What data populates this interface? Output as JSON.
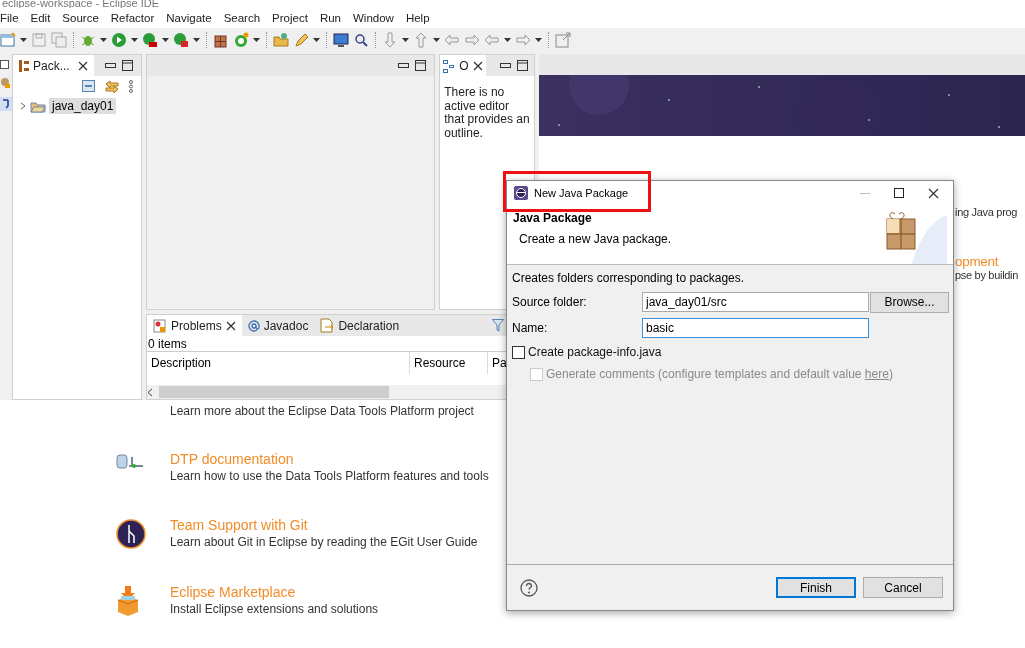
{
  "window": {
    "title": "eclipse-workspace - Eclipse IDE"
  },
  "menu": [
    "File",
    "Edit",
    "Source",
    "Refactor",
    "Navigate",
    "Search",
    "Project",
    "Run",
    "Window",
    "Help"
  ],
  "package_explorer": {
    "tab": {
      "label": "Pack...",
      "selected": true
    },
    "tree": [
      {
        "label": "java_day01",
        "expanded": false,
        "selected": true
      }
    ]
  },
  "outline": {
    "tab": {
      "label": "O",
      "selected": true
    },
    "message": "There is no active editor that provides an outline."
  },
  "problems": {
    "tabs": [
      {
        "label": "Problems",
        "selected": true,
        "kind": "problems"
      },
      {
        "label": "Javadoc",
        "selected": false,
        "kind": "javadoc"
      },
      {
        "label": "Declaration",
        "selected": false,
        "kind": "declaration"
      }
    ],
    "summary": "0 items",
    "columns": [
      "Description",
      "Resource",
      "Pa"
    ]
  },
  "welcome": {
    "partial_lines": [
      {
        "text": "ing Java prog",
        "kind": "desc"
      },
      {
        "text": "opment",
        "kind": "link"
      },
      {
        "text": "pse by buildin",
        "kind": "desc"
      }
    ],
    "items": [
      {
        "kind": "hidden",
        "description": "Learn more about the Eclipse Data Tools Platform project"
      },
      {
        "kind": "database",
        "title": "DTP documentation",
        "description": "Learn how to use the Data Tools Platform features and tools"
      },
      {
        "kind": "git",
        "title": "Team Support with Git",
        "description": "Learn about Git in Eclipse by reading the EGit User Guide"
      },
      {
        "kind": "marketplace",
        "title": "Eclipse Marketplace",
        "description": "Install Eclipse extensions and solutions"
      }
    ]
  },
  "dialog": {
    "title": "New Java Package",
    "highlighted": true,
    "heading": "Java Package",
    "subtitle": "Create a new Java package.",
    "message": "Creates folders corresponding to packages.",
    "fields": [
      {
        "label": "Source folder:",
        "value": "java_day01/src",
        "focused": false,
        "button": "Browse..."
      },
      {
        "label": "Name:",
        "value": "basic",
        "focused": true
      }
    ],
    "options": [
      {
        "label": "Create package-info.java",
        "checked": false,
        "disabled": false
      },
      {
        "label": "Generate comments (configure templates and default value ",
        "link": "here",
        "suffix": ")",
        "checked": false,
        "disabled": true
      }
    ],
    "buttons": [
      {
        "label": "Finish",
        "default": true
      },
      {
        "label": "Cancel",
        "default": false
      }
    ]
  }
}
